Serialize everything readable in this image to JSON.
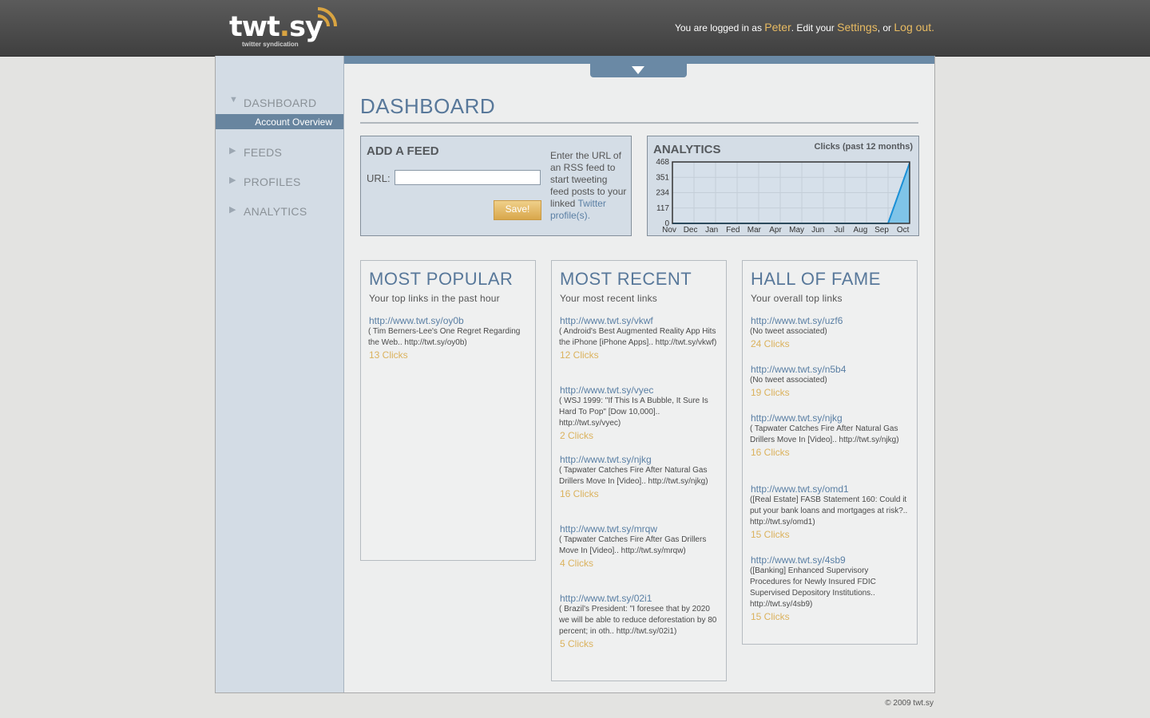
{
  "header": {
    "logo_text": "twt",
    "logo_dot": ".",
    "logo_suffix": "sy",
    "logo_sub": "twitter syndication",
    "logged_in_prefix": "You are logged in as ",
    "user": "Peter",
    "edit_text": ". Edit your ",
    "settings": "Settings",
    "or_text": ", or ",
    "logout": "Log out",
    "end": "."
  },
  "sidebar": {
    "items": [
      {
        "label": "DASHBOARD",
        "arrow": "▼"
      },
      {
        "label": "FEEDS",
        "arrow": "▶"
      },
      {
        "label": "PROFILES",
        "arrow": "▶"
      },
      {
        "label": "ANALYTICS",
        "arrow": "▶"
      }
    ],
    "active_sub": "Account Overview"
  },
  "page": {
    "title": "DASHBOARD"
  },
  "add_feed": {
    "title": "ADD A FEED",
    "url_label": "URL:",
    "url_value": "",
    "save_label": "Save!",
    "help_text": "Enter the URL of an RSS feed to start tweeting feed posts to your linked ",
    "help_link": "Twitter profile(s)",
    "help_end": "."
  },
  "analytics": {
    "title": "ANALYTICS",
    "caption": "Clicks (past 12 months)"
  },
  "chart_data": {
    "type": "area",
    "categories": [
      "Nov",
      "Dec",
      "Jan",
      "Fed",
      "Mar",
      "Apr",
      "May",
      "Jun",
      "Jul",
      "Aug",
      "Sep",
      "Oct"
    ],
    "values": [
      0,
      0,
      0,
      0,
      0,
      0,
      0,
      0,
      0,
      0,
      0,
      460
    ],
    "yticks": [
      0,
      117,
      234,
      351,
      468
    ],
    "ylim": [
      0,
      468
    ],
    "grid": true,
    "colors": {
      "line": "#1a8fd6",
      "fill": "#7fc4e8",
      "axis": "#333333",
      "grid": "#c4ced8"
    }
  },
  "most_popular": {
    "title": "MOST POPULAR",
    "subtitle": "Your top links in the past hour",
    "items": [
      {
        "url": "http://www.twt.sy/oy0b",
        "desc": "( Tim Berners-Lee's One Regret Regarding the Web.. http://twt.sy/oy0b)",
        "clicks": "13 Clicks"
      }
    ]
  },
  "most_recent": {
    "title": "MOST RECENT",
    "subtitle": "Your most recent links",
    "items": [
      {
        "url": "http://www.twt.sy/vkwf",
        "desc": "( Android's Best Augmented Reality App Hits the iPhone [iPhone Apps].. http://twt.sy/vkwf)",
        "clicks": "12 Clicks"
      },
      {
        "url": "http://www.twt.sy/vyec",
        "desc": "( WSJ 1999: \"If This Is A Bubble, It Sure Is Hard To Pop\" [Dow 10,000].. http://twt.sy/vyec)",
        "clicks": "2 Clicks"
      },
      {
        "url": "http://www.twt.sy/njkg",
        "desc": "( Tapwater Catches Fire After Natural Gas Drillers Move In [Video].. http://twt.sy/njkg)",
        "clicks": "16 Clicks"
      },
      {
        "url": "http://www.twt.sy/mrqw",
        "desc": "( Tapwater Catches Fire After Gas Drillers Move In [Video].. http://twt.sy/mrqw)",
        "clicks": "4 Clicks"
      },
      {
        "url": "http://www.twt.sy/02i1",
        "desc": "( Brazil's President: \"I foresee that by 2020 we will be able to reduce deforestation by 80 percent; in oth.. http://twt.sy/02i1)",
        "clicks": "5 Clicks"
      }
    ]
  },
  "hall_of_fame": {
    "title": "HALL OF FAME",
    "subtitle": "Your overall top links",
    "items": [
      {
        "url": "http://www.twt.sy/uzf6",
        "desc": "(No tweet associated)",
        "clicks": "24 Clicks"
      },
      {
        "url": "http://www.twt.sy/n5b4",
        "desc": "(No tweet associated)",
        "clicks": "19 Clicks"
      },
      {
        "url": "http://www.twt.sy/njkg",
        "desc": "( Tapwater Catches Fire After Natural Gas Drillers Move In [Video].. http://twt.sy/njkg)",
        "clicks": "16 Clicks"
      },
      {
        "url": "http://www.twt.sy/omd1",
        "desc": "([Real Estate] FASB Statement 160: Could it put your bank loans and mortgages at risk?.. http://twt.sy/omd1)",
        "clicks": "15 Clicks"
      },
      {
        "url": "http://www.twt.sy/4sb9",
        "desc": "([Banking] Enhanced Supervisory Procedures for Newly Insured FDIC Supervised Depository Institutions.. http://twt.sy/4sb9)",
        "clicks": "15 Clicks"
      }
    ]
  },
  "footer": {
    "text": "© 2009 twt.sy"
  }
}
